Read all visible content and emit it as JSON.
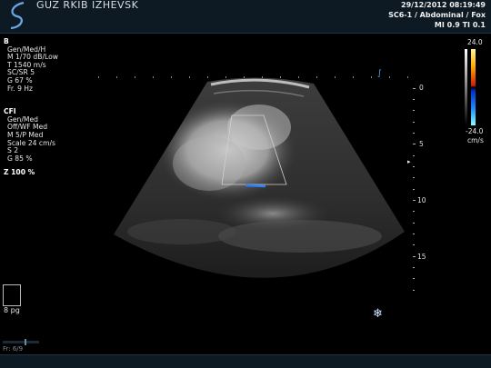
{
  "header": {
    "logo_icon": "s-curve-logo-icon",
    "institution": "GUZ RKIB IZHEVSK",
    "datetime": "29/12/2012 08:19:49",
    "probe_preset": "SC6-1 / Abdominal / Fox",
    "indices": "MI 0.9   TI 0.1"
  },
  "b_mode": {
    "title": "B",
    "lines": [
      "Gen/Med/H",
      "M 1/70 dB/Low",
      "T 1540 m/s",
      "SC/SR 5",
      "G 67 %",
      "Fr. 9 Hz"
    ]
  },
  "cfi": {
    "title": "CFI",
    "lines": [
      "Gen/Med",
      "Off/WF Med",
      "M 5/P Med",
      "Scale 24 cm/s",
      "S 2",
      "G 85 %"
    ]
  },
  "zoom": "Z  100  %",
  "depth_ticks": [
    "0",
    "5",
    "10",
    "15"
  ],
  "color_scale": {
    "max": "24.0",
    "min": "-24.0",
    "unit": "cm/s"
  },
  "page_label": "8 pg",
  "frame_label": "Fr: 6/9",
  "icons": {
    "freeze": "snowflake-icon",
    "probe_orientation": "probe-orientation-icon",
    "focus": "focus-marker-icon"
  },
  "colors": {
    "header_bg": "#0d1a24",
    "accent_blue": "#6aa9e8",
    "color_roi_box": "#d0d0d0"
  }
}
